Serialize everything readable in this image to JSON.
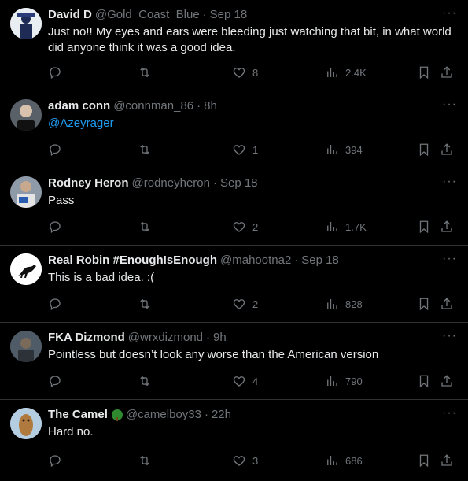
{
  "tweets": [
    {
      "name": "David D",
      "handle": "@Gold_Coast_Blue",
      "time": "Sep 18",
      "text": "Just no!! My eyes and ears were bleeding just watching that bit, in what world did anyone think it was a good idea.",
      "replies": "",
      "retweets": "",
      "likes": "8",
      "views": "2.4K",
      "avatar_color": "#dfe6ee"
    },
    {
      "name": "adam conn",
      "handle": "@connman_86",
      "time": "8h",
      "text": "@Azeyrager",
      "replies": "",
      "retweets": "",
      "likes": "1",
      "views": "394",
      "avatar_color": "#3a3f46"
    },
    {
      "name": "Rodney Heron",
      "handle": "@rodneyheron",
      "time": "Sep 18",
      "text": "Pass",
      "replies": "",
      "retweets": "",
      "likes": "2",
      "views": "1.7K",
      "avatar_color": "#6d7b8c"
    },
    {
      "name": "Real Robin #EnoughIsEnough",
      "handle": "@mahootna2",
      "time": "Sep 18",
      "text": "This is a bad idea. :(",
      "replies": "",
      "retweets": "",
      "likes": "2",
      "views": "828",
      "avatar_color": "#ffffff"
    },
    {
      "name": "FKA Dizmond",
      "handle": "@wrxdizmond",
      "time": "9h",
      "text": "Pointless but doesn’t look any worse than the American version",
      "replies": "",
      "retweets": "",
      "likes": "4",
      "views": "790",
      "avatar_color": "#4a5560"
    },
    {
      "name": "The Camel",
      "handle": "@camelboy33",
      "time": "22h",
      "text": "Hard no.",
      "replies": "",
      "retweets": "",
      "likes": "3",
      "views": "686",
      "avatar_color": "#a8c4d8"
    }
  ],
  "more_glyph": "···",
  "colors": {
    "background": "#000000",
    "text": "#e7e9ea",
    "muted": "#71767b",
    "link": "#1d9bf0",
    "divider": "#2f3336"
  }
}
